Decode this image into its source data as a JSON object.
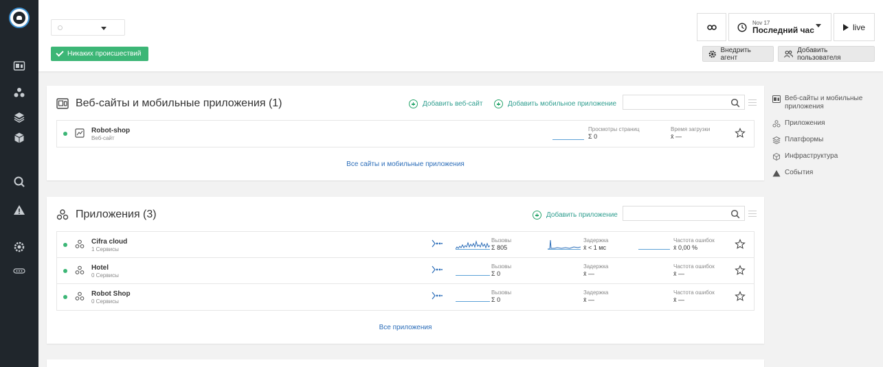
{
  "header": {
    "incident_label": "Никаких происшествий",
    "time": {
      "date": "Nov 17",
      "range": "Последний час",
      "live_label": "live"
    },
    "deploy_agent_label": "Внедрить агент",
    "add_user_label": "Добавить пользователя"
  },
  "websites": {
    "title": "Веб-сайты и мобильные приложения (1)",
    "add_website_label": "Добавить веб-сайт",
    "add_mobile_label": "Добавить мобильное приложение",
    "search_placeholder": "",
    "rows": [
      {
        "name": "Robot-shop",
        "sub": "Веб-сайт",
        "pageviews_label": "Просмотры страниц",
        "pageviews_value": "Σ 0",
        "load_label": "Время загрузки",
        "load_value": "x̄ —"
      }
    ],
    "all_link": "Все сайты и мобильные приложения"
  },
  "applications": {
    "title": "Приложения (3)",
    "add_label": "Добавить приложение",
    "search_placeholder": "",
    "rows": [
      {
        "name": "Cifra cloud",
        "sub": "1 Сервисы",
        "calls_label": "Вызовы",
        "calls_value": "Σ 805",
        "latency_label": "Задержка",
        "latency_value": "x̄ < 1 мс",
        "errors_label": "Частота ошибок",
        "errors_value": "x̄ 0,00 %"
      },
      {
        "name": "Hotel",
        "sub": "0 Сервисы",
        "calls_label": "Вызовы",
        "calls_value": "Σ 0",
        "latency_label": "Задержка",
        "latency_value": "x̄ —",
        "errors_label": "Частота ошибок",
        "errors_value": "x̄ —"
      },
      {
        "name": "Robot Shop",
        "sub": "0 Сервисы",
        "calls_label": "Вызовы",
        "calls_value": "Σ 0",
        "latency_label": "Задержка",
        "latency_value": "x̄ —",
        "errors_label": "Частота ошибок",
        "errors_value": "x̄ —"
      }
    ],
    "all_link": "Все приложения"
  },
  "index": {
    "items": [
      "Веб-сайты и мобильные приложения",
      "Приложения",
      "Платформы",
      "Инфраструктура",
      "События"
    ]
  },
  "colors": {
    "nav_bg": "#20262c",
    "success": "#3cb676",
    "link": "#2a6cb8",
    "add_link": "#2f9e8f"
  }
}
